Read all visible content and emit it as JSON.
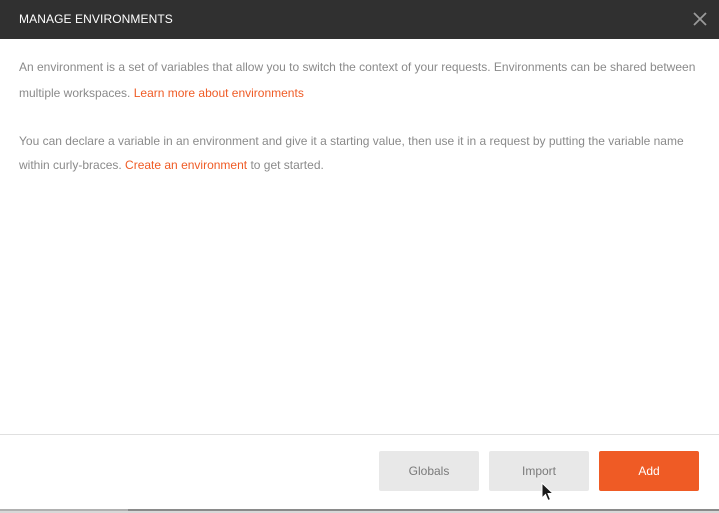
{
  "header": {
    "title": "MANAGE ENVIRONMENTS"
  },
  "body": {
    "para1_text": "An environment is a set of variables that allow you to switch the context of your requests. Environments can be shared between multiple workspaces. ",
    "para1_link": "Learn more about environments",
    "para2_text_before": "You can declare a variable in an environment and give it a starting value, then use it in a request by putting the variable name within curly-braces. ",
    "para2_link": "Create an environment",
    "para2_text_after": " to get started."
  },
  "footer": {
    "globals_label": "Globals",
    "import_label": "Import",
    "add_label": "Add"
  },
  "colors": {
    "header_bg": "#303030",
    "accent": "#ef5b25",
    "secondary_button_bg": "#e8e8e8",
    "body_text": "#8a8a8a"
  },
  "icons": [
    "close-icon",
    "mouse-cursor-icon"
  ]
}
